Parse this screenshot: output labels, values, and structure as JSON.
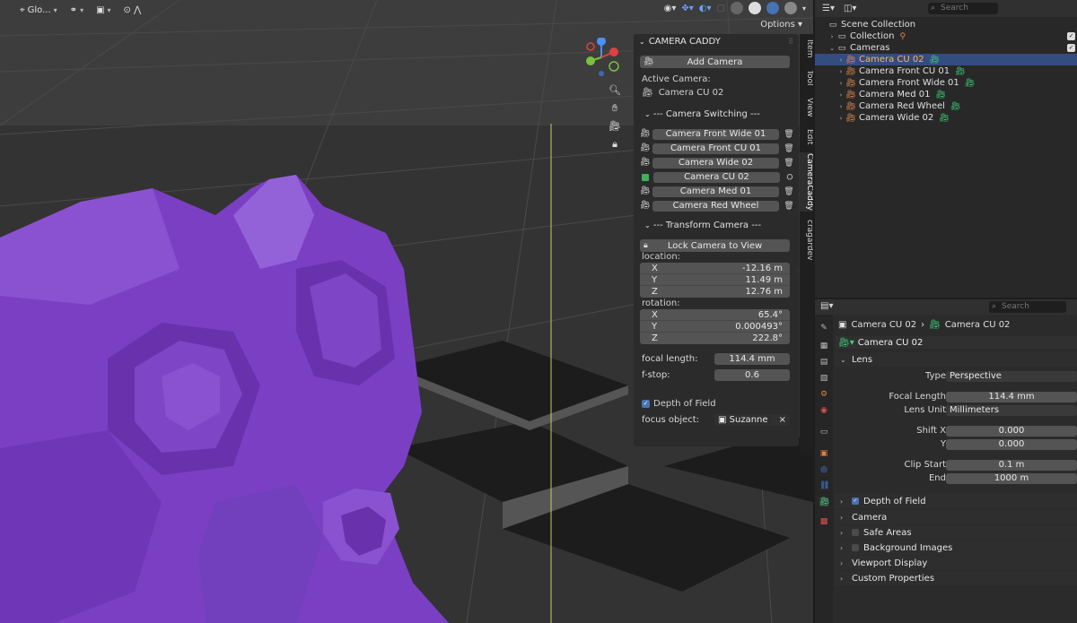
{
  "viewport": {
    "header": {
      "transform_orientation": "Glo...",
      "options_label": "Options"
    }
  },
  "camera_caddy": {
    "title": "CAMERA CADDY",
    "add_camera": "Add Camera",
    "active_camera_label": "Active Camera:",
    "active_camera_value": "Camera CU 02",
    "switching_header": "--- Camera Switching ---",
    "cameras": [
      {
        "name": "Camera Front Wide 01",
        "active": false
      },
      {
        "name": "Camera Front CU 01",
        "active": false
      },
      {
        "name": "Camera Wide 02",
        "active": false
      },
      {
        "name": "Camera CU 02",
        "active": true
      },
      {
        "name": "Camera Med 01",
        "active": false
      },
      {
        "name": "Camera Red Wheel",
        "active": false
      }
    ],
    "transform_header": "--- Transform Camera ---",
    "lock_camera": "Lock Camera to View",
    "location_label": "location:",
    "location": {
      "x": "-12.16 m",
      "y": "11.49 m",
      "z": "12.76 m"
    },
    "rotation_label": "rotation:",
    "rotation": {
      "x": "65.4°",
      "y": "0.000493°",
      "z": "222.8°"
    },
    "axis": {
      "x": "X",
      "y": "Y",
      "z": "Z"
    },
    "focal_length_label": "focal length:",
    "focal_length": "114.4 mm",
    "fstop_label": "f-stop:",
    "fstop": "0.6",
    "dof_label": "Depth of Field",
    "focus_object_label": "focus object:",
    "focus_object": "Suzanne"
  },
  "sidebar_tabs": [
    "Item",
    "Tool",
    "View",
    "Edit",
    "CameraCaddy",
    "cragardev"
  ],
  "outliner": {
    "search_placeholder": "Search",
    "rows": [
      {
        "label": "Scene Collection",
        "level": 0
      },
      {
        "label": "Collection",
        "level": 1
      },
      {
        "label": "Cameras",
        "level": 1
      },
      {
        "label": "Camera CU 02",
        "level": 2,
        "selected": true
      },
      {
        "label": "Camera Front CU 01",
        "level": 2
      },
      {
        "label": "Camera Front Wide 01",
        "level": 2
      },
      {
        "label": "Camera Med 01",
        "level": 2
      },
      {
        "label": "Camera Red Wheel",
        "level": 2
      },
      {
        "label": "Camera Wide 02",
        "level": 2
      }
    ]
  },
  "properties": {
    "search_placeholder": "Search",
    "breadcrumb_object": "Camera CU 02",
    "breadcrumb_data": "Camera CU 02",
    "data_name": "Camera CU 02",
    "lens_panel": "Lens",
    "type_label": "Type",
    "type_value": "Perspective",
    "focal_length_label": "Focal Length",
    "focal_length_value": "114.4 mm",
    "lens_unit_label": "Lens Unit",
    "lens_unit_value": "Millimeters",
    "shift_x_label": "Shift X",
    "shift_x_value": "0.000",
    "shift_y_label": "Y",
    "shift_y_value": "0.000",
    "clip_start_label": "Clip Start",
    "clip_start_value": "0.1 m",
    "clip_end_label": "End",
    "clip_end_value": "1000 m",
    "panels": [
      "Depth of Field",
      "Camera",
      "Safe Areas",
      "Background Images",
      "Viewport Display",
      "Custom Properties"
    ]
  },
  "colors": {
    "accent": "#4772b3",
    "selection_row": "#334d80",
    "selected_text": "#ffb35c",
    "suzanne": "#7b3fc4",
    "camera_green": "#3cb35a"
  }
}
